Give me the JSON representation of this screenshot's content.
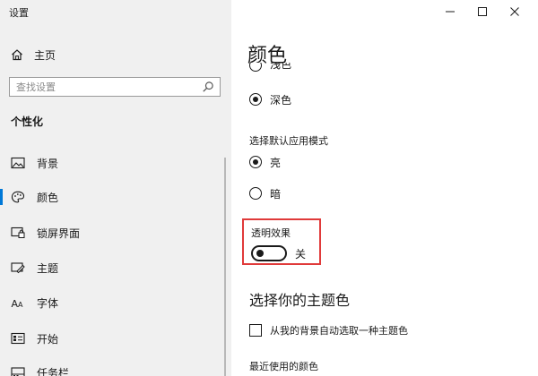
{
  "window": {
    "title": "设置",
    "controls": [
      "minimize",
      "maximize",
      "close"
    ]
  },
  "sidebar": {
    "home_label": "主页",
    "search": {
      "placeholder": "查找设置"
    },
    "section_title": "个性化",
    "items": [
      {
        "label": "背景",
        "icon": "picture-icon",
        "active": false
      },
      {
        "label": "颜色",
        "icon": "palette-icon",
        "active": true
      },
      {
        "label": "锁屏界面",
        "icon": "lock-screen-icon",
        "active": false
      },
      {
        "label": "主题",
        "icon": "theme-icon",
        "active": false
      },
      {
        "label": "字体",
        "icon": "font-icon",
        "active": false
      },
      {
        "label": "开始",
        "icon": "start-icon",
        "active": false
      },
      {
        "label": "任务栏",
        "icon": "taskbar-icon",
        "active": false
      }
    ]
  },
  "main": {
    "title": "颜色",
    "windows_mode": {
      "options": [
        {
          "label": "浅色",
          "selected": false
        },
        {
          "label": "深色",
          "selected": true
        }
      ]
    },
    "app_mode": {
      "label": "选择默认应用模式",
      "options": [
        {
          "label": "亮",
          "selected": true
        },
        {
          "label": "暗",
          "selected": false
        }
      ]
    },
    "transparency": {
      "label": "透明效果",
      "state_label": "关",
      "on": false
    },
    "accent_heading": "选择你的主题色",
    "auto_accent": {
      "label": "从我的背景自动选取一种主题色",
      "checked": false
    },
    "recent_colors_label": "最近使用的颜色"
  },
  "colors": {
    "sidebar_bg": "#f0f0f0",
    "accent": "#0078d7",
    "highlight_box": "#e03a3a"
  }
}
